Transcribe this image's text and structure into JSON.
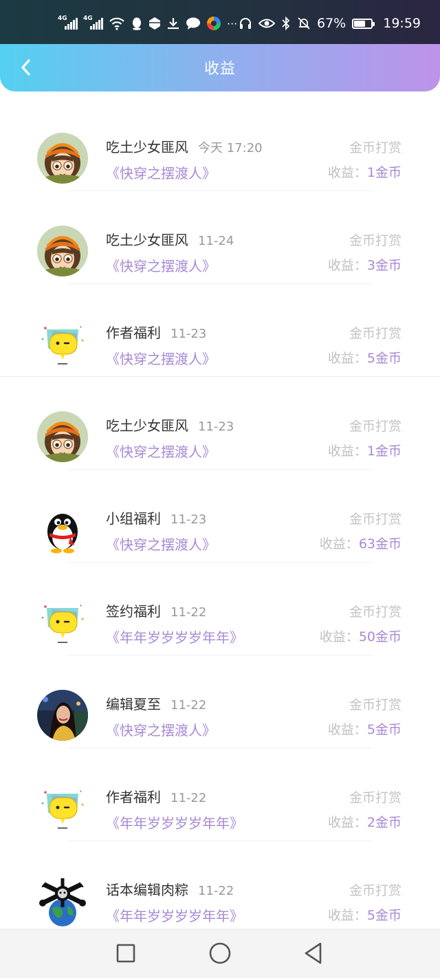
{
  "status_bar": {
    "net1": "4G",
    "net2": "4G",
    "more": "···",
    "battery_text": "67%",
    "battery_level": 0.67,
    "time": "19:59"
  },
  "header": {
    "title": "收益"
  },
  "income_items": [
    {
      "avatar": "anime-girl",
      "name": "吃土少女匪风",
      "date": "今天 17:20",
      "book": "《快穿之摆渡人》",
      "type": "金币打赏",
      "earn_label": "收益：",
      "earn_amount": "1金币"
    },
    {
      "avatar": "anime-girl",
      "name": "吃土少女匪风",
      "date": "11-24",
      "book": "《快穿之摆渡人》",
      "type": "金币打赏",
      "earn_label": "收益：",
      "earn_amount": "3金币"
    },
    {
      "avatar": "yellow-chat",
      "name": "作者福利",
      "date": "11-23",
      "book": "《快穿之摆渡人》",
      "type": "金币打赏",
      "earn_label": "收益：",
      "earn_amount": "5金币"
    },
    {
      "avatar": "anime-girl",
      "name": "吃土少女匪风",
      "date": "11-23",
      "book": "《快穿之摆渡人》",
      "type": "金币打赏",
      "earn_label": "收益：",
      "earn_amount": "1金币"
    },
    {
      "avatar": "penguin",
      "name": "小组福利",
      "date": "11-23",
      "book": "《快穿之摆渡人》",
      "type": "金币打赏",
      "earn_label": "收益：",
      "earn_amount": "63金币"
    },
    {
      "avatar": "yellow-chat",
      "name": "签约福利",
      "date": "11-22",
      "book": "《年年岁岁岁岁年年》",
      "type": "金币打赏",
      "earn_label": "收益：",
      "earn_amount": "50金币"
    },
    {
      "avatar": "photo-woman",
      "name": "编辑夏至",
      "date": "11-22",
      "book": "《快穿之摆渡人》",
      "type": "金币打赏",
      "earn_label": "收益：",
      "earn_amount": "5金币"
    },
    {
      "avatar": "yellow-chat",
      "name": "作者福利",
      "date": "11-22",
      "book": "《年年岁岁岁岁年年》",
      "type": "金币打赏",
      "earn_label": "收益：",
      "earn_amount": "2金币"
    },
    {
      "avatar": "globe-skull",
      "name": "话本编辑肉粽",
      "date": "11-22",
      "book": "《年年岁岁岁岁年年》",
      "type": "金币打赏",
      "earn_label": "收益：",
      "earn_amount": "5金币"
    }
  ],
  "colors": {
    "accent": "#a889d4",
    "header_gradient_start": "#54d0f0",
    "header_gradient_end": "#bd93ea"
  }
}
